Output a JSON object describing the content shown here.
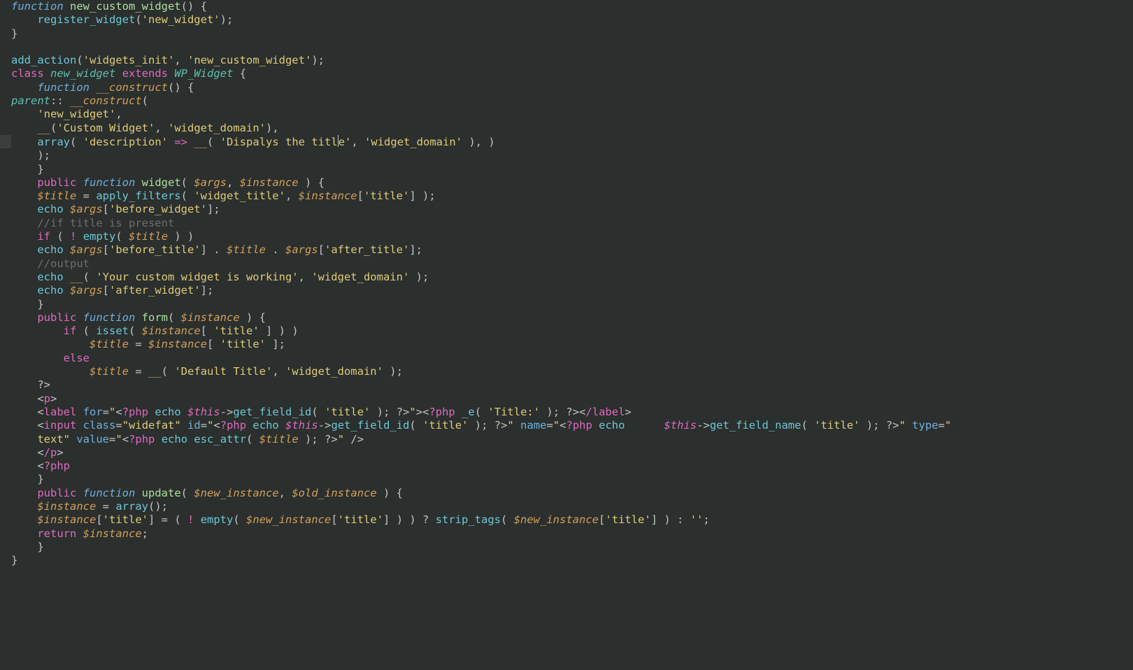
{
  "editor": {
    "cursor_line": 12,
    "strings": {
      "new_widget": "'new_widget'",
      "widgets_init": "'widgets_init'",
      "new_custom_widget": "'new_custom_widget'",
      "custom_widget_label": "'Custom Widget'",
      "widget_domain": "'widget_domain'",
      "description": "'description'",
      "dispalys_title": "'Dispalys the title'",
      "widget_title": "'widget_title'",
      "title_key": "'title'",
      "before_widget": "'before_widget'",
      "before_title": "'before_title'",
      "after_title": "'after_title'",
      "after_widget": "'after_widget'",
      "working_msg": "'Your custom widget is working'",
      "default_title": "'Default Title'",
      "title_label": "'Title:'",
      "widefat": "\"widefat\"",
      "text": "text",
      "empty_str": "''"
    },
    "comments": {
      "if_title": "//if title is present",
      "output": "//output"
    },
    "identifiers": {
      "function": "function",
      "class": "class",
      "extends": "extends",
      "public": "public",
      "if": "if",
      "else": "else",
      "return": "return",
      "new_custom_widget": "new_custom_widget",
      "register_widget": "register_widget",
      "add_action": "add_action",
      "new_widget": "new_widget",
      "WP_Widget": "WP_Widget",
      "parent": "parent",
      "construct": "__construct",
      "widget": "widget",
      "form": "form",
      "update": "update",
      "apply_filters": "apply_filters",
      "empty": "empty",
      "isset": "isset",
      "echo": "echo",
      "array": "array",
      "magic": "__",
      "e_fn": "_e",
      "esc_attr": "esc_attr",
      "strip_tags": "strip_tags",
      "get_field_id": "get_field_id",
      "get_field_name": "get_field_name"
    },
    "vars": {
      "args": "$args",
      "instance": "$instance",
      "title": "$title",
      "new_instance": "$new_instance",
      "old_instance": "$old_instance",
      "this": "$this"
    },
    "tags": {
      "p_open": "p",
      "p_close": "/p",
      "label_open": "label",
      "label_close": "/label",
      "input": "input",
      "php_open": "?php",
      "php_close": "?",
      "php_close_tag": "?>"
    },
    "attrs": {
      "for": "for",
      "class": "class",
      "id": "id",
      "name": "name",
      "type": "type",
      "value": "value"
    }
  }
}
